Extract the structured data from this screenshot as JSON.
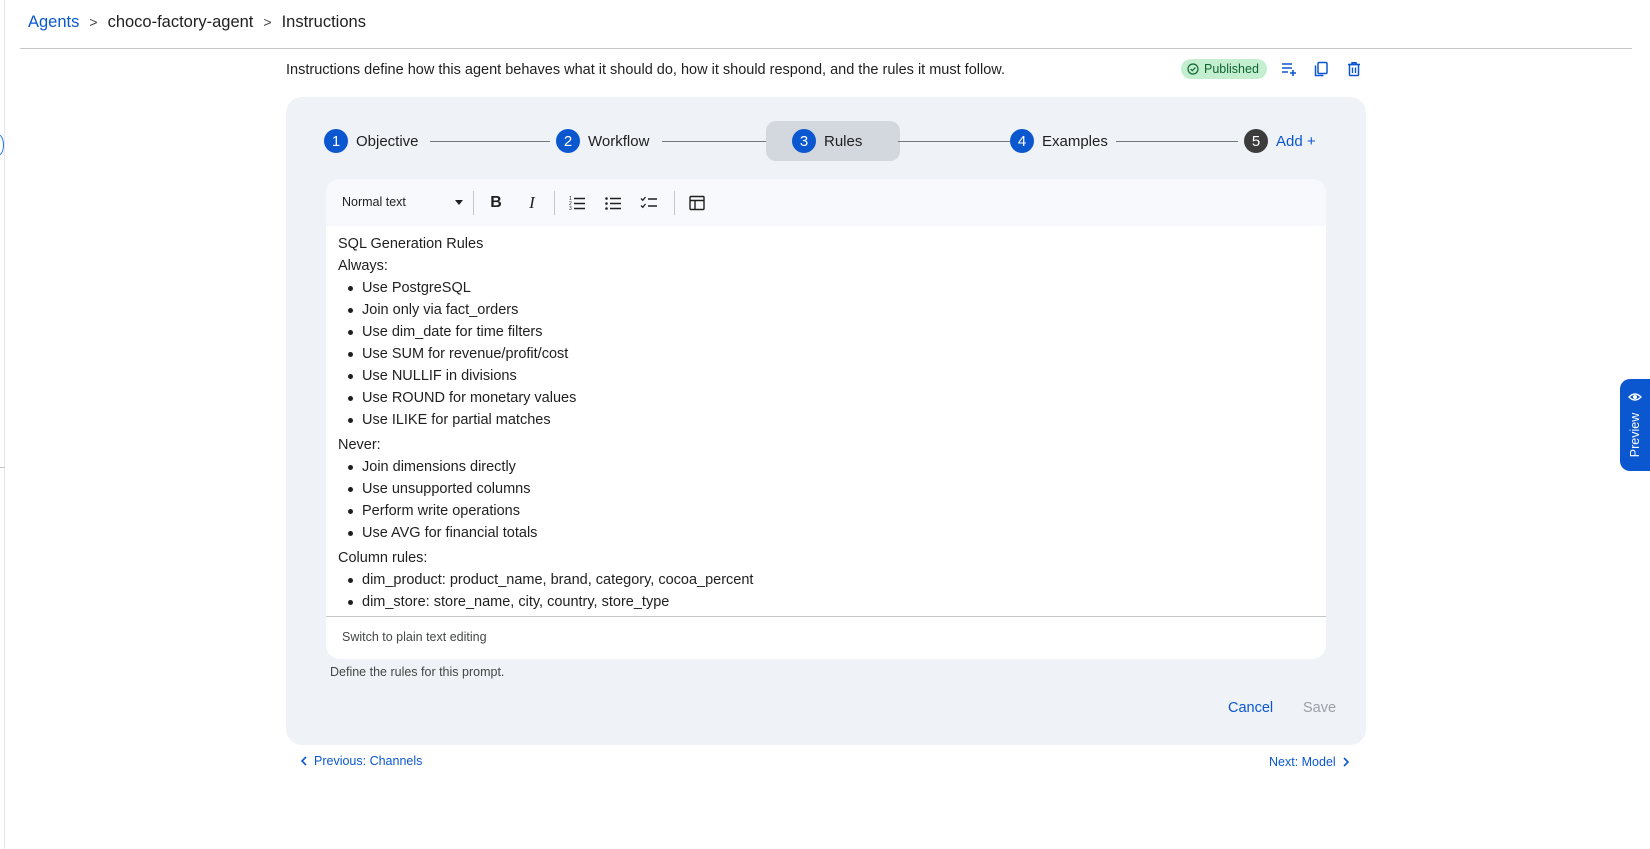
{
  "breadcrumb": {
    "items": [
      {
        "label": "Agents"
      },
      {
        "label": "choco-factory-agent"
      },
      {
        "label": "Instructions"
      }
    ],
    "separator": ">"
  },
  "page": {
    "description": "Instructions define how this agent behaves what it should do, how it should respond, and the rules it must follow.",
    "status": "Published",
    "actions": [
      "add-note-icon",
      "copy-icon",
      "delete-icon"
    ]
  },
  "stepper": {
    "steps": [
      {
        "number": "1",
        "label": "Objective"
      },
      {
        "number": "2",
        "label": "Workflow"
      },
      {
        "number": "3",
        "label": "Rules"
      },
      {
        "number": "4",
        "label": "Examples"
      },
      {
        "number": "5",
        "label": "Add +"
      }
    ],
    "active": "Rules"
  },
  "editor": {
    "format": "Normal text",
    "toolbar": [
      "bold-icon",
      "italic-icon",
      "numbered-list-icon",
      "bulleted-list-icon",
      "checklist-icon",
      "table-icon"
    ],
    "heading": "SQL Generation Rules",
    "groups": [
      {
        "title": "Always:",
        "items": [
          "Use PostgreSQL",
          "Join only via fact_orders",
          "Use dim_date for time filters",
          "Use SUM for revenue/profit/cost",
          "Use NULLIF in divisions",
          "Use ROUND for monetary values",
          "Use ILIKE for partial matches"
        ]
      },
      {
        "title": "Never:",
        "items": [
          "Join dimensions directly",
          "Use unsupported columns",
          "Perform write operations",
          "Use AVG for financial totals"
        ]
      },
      {
        "title": "Column rules:",
        "items": [
          "dim_product: product_name, brand, category, cocoa_percent",
          "dim_store: store_name, city, country, store_type"
        ]
      }
    ],
    "plain_text_toggle": "Switch to plain text editing",
    "helper": "Define the rules for this prompt."
  },
  "buttons": {
    "cancel": "Cancel",
    "save": "Save"
  },
  "nav": {
    "previous": "Previous: Channels",
    "next": "Next: Model"
  },
  "preview": {
    "label": "Preview"
  },
  "colors": {
    "accent": "#0b57d0",
    "card_background": "#eff2f7",
    "badge_background": "#c4eed0",
    "badge_text": "#0d652d"
  }
}
